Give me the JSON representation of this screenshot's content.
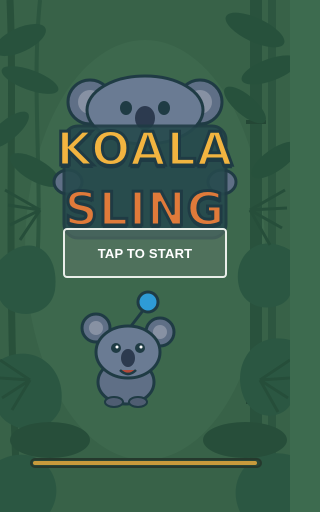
{
  "title": {
    "line1": "KOALA",
    "line2": "SLING"
  },
  "start_button": {
    "label": "TAP TO START"
  },
  "power_bar": {
    "fill_fraction": 0.99
  },
  "colors": {
    "background": "#3d6b4f",
    "leaf_dark": "#2b5a43",
    "leaf_light": "#4f8765",
    "title_yellow": "#f2b440",
    "title_orange": "#e07a3a",
    "outline": "#1f3b44",
    "koala_grey": "#5f6f86",
    "ball_blue": "#2e9bd6"
  },
  "icons": {
    "character": "koala-icon",
    "ball": "ball-icon"
  }
}
